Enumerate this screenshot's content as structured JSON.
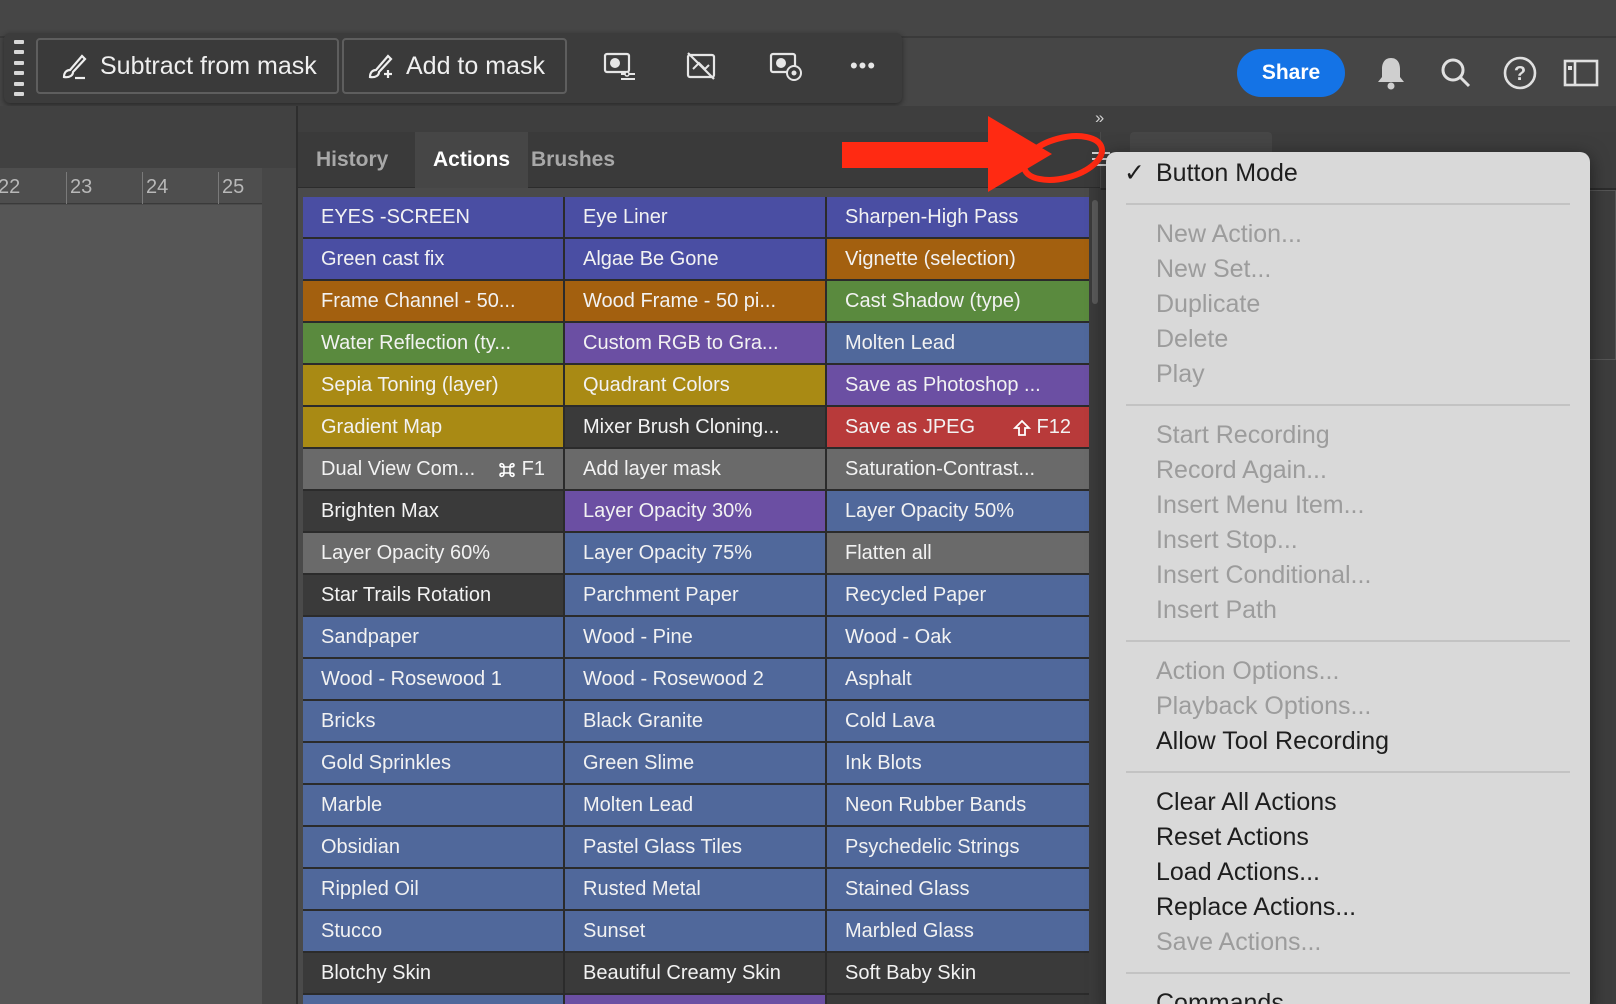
{
  "toolbar": {
    "subtract_label": "Subtract from mask",
    "add_label": "Add to mask",
    "more_label": "•••"
  },
  "header": {
    "share_label": "Share"
  },
  "ruler": {
    "labels": [
      "22",
      "23",
      "24",
      "25"
    ]
  },
  "tabs": [
    {
      "label": "History",
      "active": false
    },
    {
      "label": "Actions",
      "active": true
    },
    {
      "label": "Brushes",
      "active": false
    }
  ],
  "collapse_label": "››",
  "colors": {
    "blue": "#5165a5",
    "steel": "#50689b",
    "orange": "#a3600f",
    "green": "#5a8a3e",
    "purple": "#6b4fa3",
    "yellow": "#a98a14",
    "red": "#b83a3a",
    "gray": "#6a6a6a",
    "dark": "#3a3a3a",
    "indigo": "#4a4ea3",
    "share": "#1473e6"
  },
  "actions": {
    "rows": [
      [
        {
          "label": "EYES -SCREEN",
          "color": "indigo"
        },
        {
          "label": "Eye Liner",
          "color": "indigo"
        },
        {
          "label": "Sharpen-High Pass",
          "color": "indigo"
        }
      ],
      [
        {
          "label": "Green cast fix",
          "color": "indigo"
        },
        {
          "label": "Algae Be Gone",
          "color": "indigo"
        },
        {
          "label": "Vignette (selection)",
          "color": "orange"
        }
      ],
      [
        {
          "label": "Frame Channel - 50...",
          "color": "orange"
        },
        {
          "label": "Wood Frame - 50 pi...",
          "color": "orange"
        },
        {
          "label": "Cast Shadow (type)",
          "color": "green"
        }
      ],
      [
        {
          "label": "Water Reflection (ty...",
          "color": "green"
        },
        {
          "label": "Custom RGB to Gra...",
          "color": "purple"
        },
        {
          "label": "Molten Lead",
          "color": "steel"
        }
      ],
      [
        {
          "label": "Sepia Toning (layer)",
          "color": "yellow"
        },
        {
          "label": "Quadrant Colors",
          "color": "yellow"
        },
        {
          "label": "Save as Photoshop ...",
          "color": "purple"
        }
      ],
      [
        {
          "label": "Gradient Map",
          "color": "yellow"
        },
        {
          "label": "Mixer Brush Cloning...",
          "color": "dark"
        },
        {
          "label": "Save as JPEG",
          "color": "red",
          "shortcut": "F12",
          "shortcut_icon": "shift-key-icon"
        }
      ],
      [
        {
          "label": "Dual View Com...",
          "color": "gray",
          "shortcut": "F1",
          "shortcut_icon": "command-key-icon"
        },
        {
          "label": "Add layer mask",
          "color": "gray"
        },
        {
          "label": "Saturation-Contrast...",
          "color": "gray"
        }
      ],
      [
        {
          "label": "Brighten Max",
          "color": "dark"
        },
        {
          "label": "Layer Opacity 30%",
          "color": "purple"
        },
        {
          "label": "Layer Opacity 50%",
          "color": "steel"
        }
      ],
      [
        {
          "label": "Layer Opacity 60%",
          "color": "gray"
        },
        {
          "label": "Layer Opacity 75%",
          "color": "steel"
        },
        {
          "label": "Flatten all",
          "color": "gray"
        }
      ],
      [
        {
          "label": "Star Trails Rotation",
          "color": "dark"
        },
        {
          "label": "Parchment Paper",
          "color": "steel"
        },
        {
          "label": "Recycled Paper",
          "color": "steel"
        }
      ],
      [
        {
          "label": "Sandpaper",
          "color": "steel"
        },
        {
          "label": "Wood - Pine",
          "color": "steel"
        },
        {
          "label": "Wood - Oak",
          "color": "steel"
        }
      ],
      [
        {
          "label": "Wood - Rosewood 1",
          "color": "steel"
        },
        {
          "label": "Wood - Rosewood 2",
          "color": "steel"
        },
        {
          "label": "Asphalt",
          "color": "steel"
        }
      ],
      [
        {
          "label": "Bricks",
          "color": "steel"
        },
        {
          "label": "Black Granite",
          "color": "steel"
        },
        {
          "label": "Cold Lava",
          "color": "steel"
        }
      ],
      [
        {
          "label": "Gold Sprinkles",
          "color": "steel"
        },
        {
          "label": "Green Slime",
          "color": "steel"
        },
        {
          "label": "Ink Blots",
          "color": "steel"
        }
      ],
      [
        {
          "label": "Marble",
          "color": "steel"
        },
        {
          "label": "Molten Lead",
          "color": "steel"
        },
        {
          "label": "Neon Rubber Bands",
          "color": "steel"
        }
      ],
      [
        {
          "label": "Obsidian",
          "color": "steel"
        },
        {
          "label": "Pastel Glass Tiles",
          "color": "steel"
        },
        {
          "label": "Psychedelic Strings",
          "color": "steel"
        }
      ],
      [
        {
          "label": "Rippled Oil",
          "color": "steel"
        },
        {
          "label": "Rusted Metal",
          "color": "steel"
        },
        {
          "label": "Stained Glass",
          "color": "steel"
        }
      ],
      [
        {
          "label": "Stucco",
          "color": "steel"
        },
        {
          "label": "Sunset",
          "color": "steel"
        },
        {
          "label": "Marbled Glass",
          "color": "steel"
        }
      ],
      [
        {
          "label": "Blotchy Skin",
          "color": "dark"
        },
        {
          "label": "Beautiful Creamy Skin",
          "color": "dark"
        },
        {
          "label": "Soft Baby Skin",
          "color": "dark"
        }
      ],
      [
        {
          "label": "",
          "color": "steel"
        },
        {
          "label": "",
          "color": "purple"
        },
        {
          "label": "",
          "color": "dark"
        }
      ]
    ]
  },
  "menu": {
    "check_mark": "✓",
    "groups": [
      [
        {
          "label": "Button Mode",
          "enabled": true,
          "checked": true
        }
      ],
      [
        {
          "label": "New Action...",
          "enabled": false
        },
        {
          "label": "New Set...",
          "enabled": false
        },
        {
          "label": "Duplicate",
          "enabled": false
        },
        {
          "label": "Delete",
          "enabled": false
        },
        {
          "label": "Play",
          "enabled": false
        }
      ],
      [
        {
          "label": "Start Recording",
          "enabled": false
        },
        {
          "label": "Record Again...",
          "enabled": false
        },
        {
          "label": "Insert Menu Item...",
          "enabled": false
        },
        {
          "label": "Insert Stop...",
          "enabled": false
        },
        {
          "label": "Insert Conditional...",
          "enabled": false
        },
        {
          "label": "Insert Path",
          "enabled": false
        }
      ],
      [
        {
          "label": "Action Options...",
          "enabled": false
        },
        {
          "label": "Playback Options...",
          "enabled": false
        },
        {
          "label": "Allow Tool Recording",
          "enabled": true
        }
      ],
      [
        {
          "label": "Clear All Actions",
          "enabled": true
        },
        {
          "label": "Reset Actions",
          "enabled": true
        },
        {
          "label": "Load Actions...",
          "enabled": true
        },
        {
          "label": "Replace Actions...",
          "enabled": true
        },
        {
          "label": "Save Actions...",
          "enabled": false
        }
      ],
      [
        {
          "label": "Commands",
          "enabled": true
        }
      ]
    ]
  }
}
